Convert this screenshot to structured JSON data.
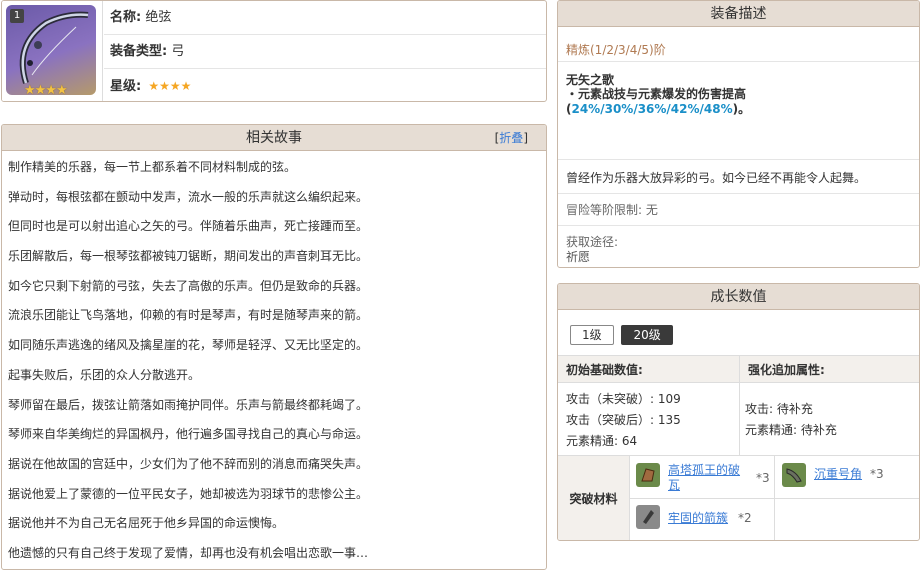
{
  "info": {
    "thumb_level": "1",
    "thumb_stars": "★★★★",
    "name_label": "名称:",
    "name_value": "绝弦",
    "type_label": "装备类型:",
    "type_value": "弓",
    "stars_label": "星级:",
    "stars_value": "★★★★"
  },
  "story": {
    "title": "相关故事",
    "fold_open": "[",
    "fold_link": "折叠",
    "fold_close": "]",
    "lines": [
      "制作精美的乐器，每一节上都系着不同材料制成的弦。",
      "弹动时，每根弦都在颤动中发声，流水一般的乐声就这么编织起来。",
      "但同时也是可以射出追心之矢的弓。伴随着乐曲声，死亡接踵而至。",
      "乐团解散后，每一根琴弦都被钝刀锯断，期间发出的声音刺耳无比。",
      "如今它只剩下射箭的弓弦，失去了高傲的乐声。但仍是致命的兵器。",
      "流浪乐团能让飞鸟落地，仰赖的有时是琴声，有时是随琴声来的箭。",
      "如同随乐声逃逸的绪风及擒星崖的花，琴师是轻浮、又无比坚定的。",
      "起事失败后，乐团的众人分散逃开。",
      "琴师留在最后，拨弦让箭落如雨掩护同伴。乐声与箭最终都耗竭了。",
      "琴师来自华美绚烂的异国枫丹，他行遍多国寻找自己的真心与命运。",
      "据说在他故国的宫廷中，少女们为了他不辞而别的消息而痛哭失声。",
      "据说他爱上了蒙德的一位平民女子，她却被选为羽球节的悲惨公主。",
      "据说他并不为自己无名屈死于他乡异国的命运懊悔。",
      "他遗憾的只有自己终于发现了爱情，却再也没有机会唱出恋歌一事…"
    ]
  },
  "desc": {
    "title": "装备描述",
    "refine": "精炼(1/2/3/4/5)阶",
    "skill_name": "无矢之歌",
    "skill_prefix": "・元素战技与元素爆发的伤害提高(",
    "skill_values": "24%/30%/36%/42%/48%",
    "skill_suffix": ")。",
    "flavor": "曾经作为乐器大放异彩的弓。如今已经不再能令人起舞。",
    "limit": "冒险等阶限制: 无",
    "source_label": "获取途径:",
    "source_value": "祈愿"
  },
  "growth": {
    "title": "成长数值",
    "levels": [
      "1级",
      "20级"
    ],
    "active_level": "20级",
    "base_header": "初始基础数值:",
    "extra_header": "强化追加属性:",
    "base_lines": [
      "攻击（未突破）: 109",
      "攻击（突破后）: 135",
      "元素精通: 64"
    ],
    "extra_lines": [
      "攻击: 待补充",
      "元素精通: 待补充"
    ],
    "materials_label": "突破材料",
    "materials": [
      {
        "name": "高塔孤王的破瓦",
        "count": "*3"
      },
      {
        "name": "沉重号角",
        "count": "*3"
      },
      {
        "name": "牢固的箭簇",
        "count": "*2"
      }
    ]
  }
}
